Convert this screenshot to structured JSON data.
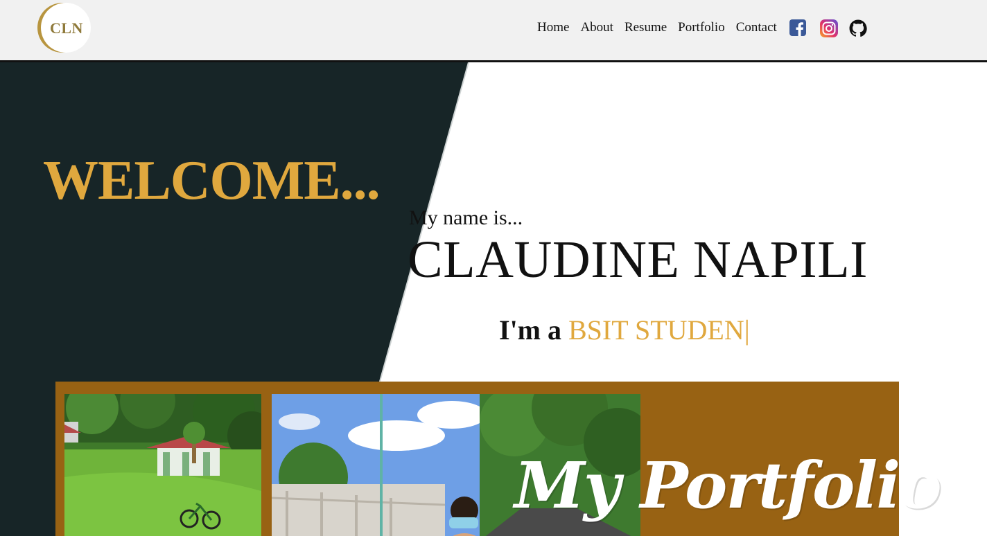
{
  "header": {
    "logo_text": "CLN",
    "nav": [
      "Home",
      "About",
      "Resume",
      "Portfolio",
      "Contact"
    ],
    "social_icons": [
      "facebook-icon",
      "instagram-icon",
      "github-icon"
    ]
  },
  "hero": {
    "welcome": "WELCOME...",
    "intro": "My name is...",
    "name": "CLAUDINE NAPILI",
    "role_prefix": "I'm a",
    "role_typed": "BSIT STUDEN",
    "cursor": "|"
  },
  "portfolio_band": {
    "title": "My Portfolio"
  },
  "colors": {
    "header_bg": "#f1f1f1",
    "dark_panel": "#172527",
    "accent_gold": "#e0a83e",
    "band_brown": "#986213",
    "logo_gold": "#8f7a3b"
  }
}
